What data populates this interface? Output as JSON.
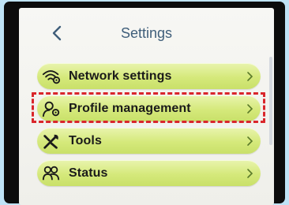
{
  "header": {
    "title": "Settings",
    "back_icon": "chevron-left-icon"
  },
  "menu": {
    "items": [
      {
        "label": "Network settings",
        "icon": "wifi-settings-icon"
      },
      {
        "label": "Profile management",
        "icon": "profile-settings-icon"
      },
      {
        "label": "Tools",
        "icon": "tools-icon"
      },
      {
        "label": "Status",
        "icon": "status-users-icon"
      }
    ],
    "chevron_icon": "chevron-right-icon",
    "highlighted_index": 1
  },
  "colors": {
    "page_background": "#bfe3f6",
    "bezel": "#0c0c0c",
    "title": "#3f5e7a",
    "item_green": "#d5e97b",
    "highlight_red": "#d9262b"
  }
}
